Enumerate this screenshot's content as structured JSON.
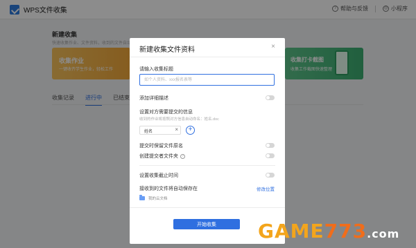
{
  "app": {
    "title": "WPS文件收集"
  },
  "topbar": {
    "help_label": "帮助与反馈",
    "miniprogram_label": "小程序"
  },
  "background": {
    "page_title": "新建收集",
    "page_subtitle": "快速收集作业、文件资料，收到的文件自动整理",
    "banner_left": {
      "title": "收集作业",
      "subtitle": "一键收齐学生作业，轻松工作"
    },
    "banner_right": {
      "title": "收集打卡截图",
      "subtitle": "收集工作截图快速整理"
    },
    "tabs": [
      "收集记录",
      "进行中",
      "已结束"
    ],
    "active_tab": "进行中"
  },
  "modal": {
    "title": "新建收集文件资料",
    "close_glyph": "×",
    "title_field_label": "请输入收集标题",
    "title_field_placeholder": "如个人资料、xxx报名表等",
    "add_description_label": "添加详细描述",
    "info_label": "设置对方需要提交的信息",
    "info_hint": "收到的作业将按照对方信息自动命名：姓名.doc",
    "chip_label": "姓名",
    "chip_remove_glyph": "×",
    "add_glyph": "+",
    "keep_filename_label": "提交时保留文件原名",
    "create_folder_label": "创建提交者文件夹",
    "help_glyph": "?",
    "deadline_label": "设置收集截止时间",
    "autosave_label": "接收到的文件将自动保存在",
    "modify_location_label": "修改位置",
    "folder_name": "我的云文档",
    "start_button": "开始收集"
  },
  "watermark": {
    "part1": "GAME",
    "part2": "773",
    "part3": ".com"
  },
  "colors": {
    "accent": "#2f6fe0",
    "overlay": "rgba(0,0,0,0.45)"
  }
}
